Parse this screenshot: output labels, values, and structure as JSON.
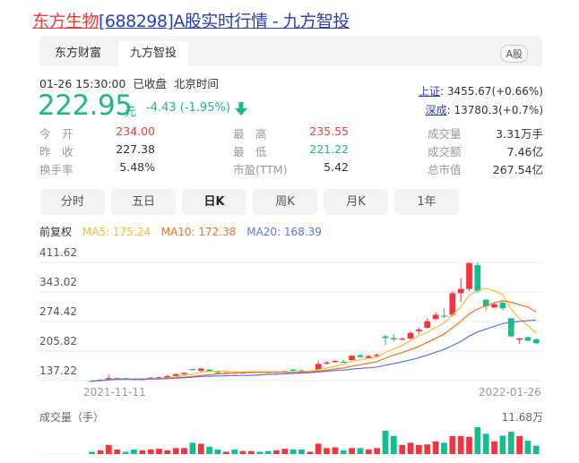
{
  "title": {
    "stock": "东方生物",
    "rest": "[688298]A股实时行情 - 九方智投"
  },
  "source_tabs": [
    "东方财富",
    "九方智投"
  ],
  "market_button": "A股",
  "status": "01-26 15:30:00  已收盘  北京时间",
  "price": "222.95",
  "unit": "元",
  "change": "-4.43 (-1.95%)",
  "indices": [
    {
      "name": "上证",
      "value": ": 3455.67(+0.66%)"
    },
    {
      "name": "深成",
      "value": ": 13780.3(+0.7%)"
    }
  ],
  "stats": [
    [
      {
        "label": "今　开",
        "value": "234.00",
        "color": "#f03a3a"
      },
      {
        "label": "最　高",
        "value": "235.55",
        "color": "#f03a3a"
      },
      {
        "label": "成交量",
        "value": "3.31万手",
        "color": "#333333"
      }
    ],
    [
      {
        "label": "昨　收",
        "value": "227.38",
        "color": "#333333"
      },
      {
        "label": "最　低",
        "value": "221.22",
        "color": "#1bb88c"
      },
      {
        "label": "成交额",
        "value": "7.46亿",
        "color": "#333333"
      }
    ],
    [
      {
        "label": "换手率",
        "value": "5.48%",
        "color": "#333333"
      },
      {
        "label": "市盈(TTM)",
        "value": "5.42",
        "color": "#333333"
      },
      {
        "label": "总市值",
        "value": "267.54亿",
        "color": "#333333"
      }
    ]
  ],
  "period_tabs": [
    "分时",
    "五日",
    "日K",
    "周K",
    "月K",
    "1年"
  ],
  "legend": {
    "adj": "前复权",
    "ma5": "MA5: 175.24",
    "ma10": "MA10: 172.38",
    "ma20": "MA20: 168.39"
  },
  "colors": {
    "up": "#f5333f",
    "down": "#13bf8e",
    "ma5": "#fdbb2c",
    "ma10": "#fc6d1e",
    "ma20": "#5b75ee"
  },
  "chart_data": {
    "type": "candlestick",
    "y_ticks": [
      "411.62",
      "343.02",
      "274.42",
      "205.82",
      "137.22"
    ],
    "ylim": [
      137.22,
      411.62
    ],
    "x_start": "2021-11-11",
    "x_end": "2022-01-26",
    "volume_label": "成交量（手）",
    "volume_max_label": "11.68万",
    "volume_max": 11.68,
    "candles": [
      [
        137,
        136,
        138,
        135
      ],
      [
        137,
        139,
        141,
        136
      ],
      [
        138,
        143,
        150,
        137
      ],
      [
        142,
        143,
        144,
        141
      ],
      [
        143,
        141,
        144,
        140
      ],
      [
        141,
        140,
        143,
        139
      ],
      [
        140,
        141,
        142,
        138
      ],
      [
        141,
        144,
        146,
        140
      ],
      [
        143,
        145,
        146,
        142
      ],
      [
        144,
        148,
        150,
        143
      ],
      [
        148,
        152,
        155,
        147
      ],
      [
        152,
        155,
        157,
        151
      ],
      [
        164,
        162,
        165,
        160
      ],
      [
        160,
        165,
        166,
        158
      ],
      [
        163,
        159,
        164,
        157
      ],
      [
        157,
        155,
        159,
        153
      ],
      [
        155,
        156,
        157,
        153
      ],
      [
        156,
        154,
        157,
        152
      ],
      [
        154,
        156,
        158,
        153
      ],
      [
        156,
        157,
        158,
        155
      ],
      [
        157,
        155,
        158,
        154
      ],
      [
        156,
        155,
        157,
        154
      ],
      [
        155,
        158,
        159,
        154
      ],
      [
        157,
        159,
        160,
        156
      ],
      [
        163,
        160,
        165,
        159
      ],
      [
        161,
        158,
        163,
        157
      ],
      [
        157,
        159,
        160,
        155
      ],
      [
        163,
        176,
        183,
        162
      ],
      [
        177,
        179,
        182,
        175
      ],
      [
        180,
        183,
        186,
        179
      ],
      [
        181,
        180,
        186,
        179
      ],
      [
        185,
        195,
        196,
        184
      ],
      [
        196,
        192,
        200,
        190
      ],
      [
        190,
        194,
        197,
        188
      ],
      [
        194,
        197,
        200,
        193
      ],
      [
        240,
        236,
        243,
        220
      ],
      [
        236,
        233,
        245,
        228
      ],
      [
        234,
        234.5,
        237,
        232
      ],
      [
        235,
        248,
        252,
        233
      ],
      [
        252,
        256,
        260,
        245
      ],
      [
        260,
        275,
        282,
        258
      ],
      [
        280,
        290,
        296,
        278
      ],
      [
        288,
        287,
        305,
        282
      ],
      [
        290,
        340,
        345,
        285
      ],
      [
        340,
        350,
        375,
        320
      ],
      [
        350,
        410,
        412,
        345
      ],
      [
        405,
        345,
        412,
        340
      ],
      [
        325,
        310,
        326,
        300
      ],
      [
        307,
        314,
        320,
        305
      ],
      [
        318,
        305,
        322,
        300
      ],
      [
        282,
        240,
        283,
        238
      ],
      [
        232,
        235,
        237,
        222
      ],
      [
        238,
        230,
        240,
        228
      ],
      [
        233,
        224,
        236,
        222
      ]
    ],
    "volumes": [
      1.0,
      1.6,
      3.9,
      2.0,
      1.0,
      2.0,
      1.6,
      2.0,
      2.3,
      1.6,
      2.6,
      2.6,
      4.9,
      4.5,
      3.2,
      2.0,
      1.0,
      2.0,
      1.3,
      1.3,
      1.0,
      1.3,
      1.6,
      2.3,
      2.0,
      2.0,
      1.0,
      4.5,
      2.6,
      2.9,
      1.6,
      2.6,
      2.6,
      2.0,
      2.6,
      10.1,
      7.8,
      3.9,
      4.9,
      3.9,
      4.2,
      5.5,
      4.9,
      7.8,
      7.8,
      7.5,
      11.68,
      8.8,
      5.5,
      8.0,
      9.7,
      7.8,
      5.8,
      3.6
    ]
  }
}
